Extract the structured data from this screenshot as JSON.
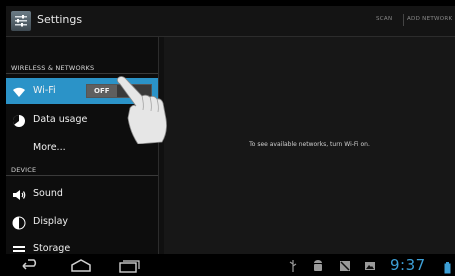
{
  "actionbar": {
    "title": "Settings",
    "scan_label": "SCAN",
    "add_network_label": "ADD NETWORK"
  },
  "sidebar": {
    "section_wireless": "WIRELESS & NETWORKS",
    "wifi_label": "Wi-Fi",
    "wifi_toggle": "OFF",
    "data_usage_label": "Data usage",
    "more_label": "More...",
    "section_device": "DEVICE",
    "sound_label": "Sound",
    "display_label": "Display",
    "storage_label": "Storage"
  },
  "content": {
    "message": "To see available networks, turn Wi-Fi on."
  },
  "statusbar": {
    "time": "9:37"
  },
  "colors": {
    "accent": "#2b93c8",
    "clock": "#3d9fd6"
  }
}
